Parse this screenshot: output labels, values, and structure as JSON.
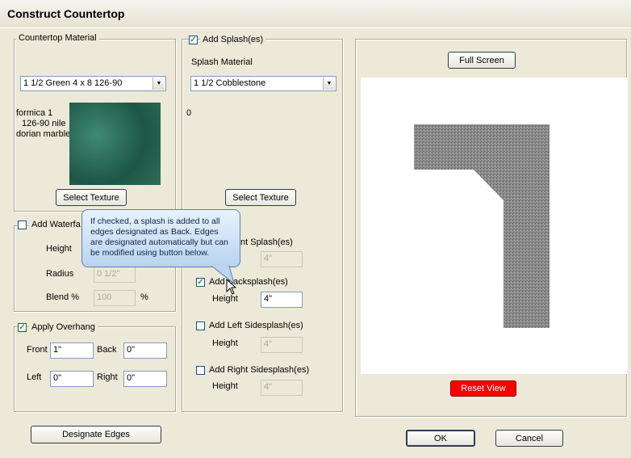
{
  "window": {
    "title": "Construct Countertop"
  },
  "countertop": {
    "group_label": "Countertop Material",
    "material": "1 1/2 Green 4 x 8 126-90",
    "desc": [
      "formica 1",
      "126-90 nile",
      "dorian marble"
    ],
    "select_texture": "Select Texture"
  },
  "waterfall": {
    "label": "Add Waterfa",
    "height_label": "Height",
    "radius_label": "Radius",
    "radius_value": "0 1/2\"",
    "blend_label": "Blend %",
    "blend_value": "100",
    "blend_unit": "%"
  },
  "overhang": {
    "label": "Apply Overhang",
    "front_label": "Front",
    "front_value": "1\"",
    "back_label": "Back",
    "back_value": "0\"",
    "left_label": "Left",
    "left_value": "0\"",
    "right_label": "Right",
    "right_value": "0\""
  },
  "designate_edges": "Designate Edges",
  "splash": {
    "add_label": "Add Splash(es)",
    "material_label": "Splash Material",
    "material": "1 1/2 Cobblestone",
    "count": "0",
    "select_texture": "Select Texture",
    "front_label": "nt Splash(es)",
    "front_height": "4\"",
    "back_label": "Add Backsplash(es)",
    "back_height_label": "Height",
    "back_height": "4\"",
    "left_label": "Add Left Sidesplash(es)",
    "left_height_label": "Height",
    "left_height": "4\"",
    "right_label": "Add Right Sidesplash(es)",
    "right_height_label": "Height",
    "right_height": "4\""
  },
  "tooltip": {
    "text": "If checked, a splash is added to all edges designated as Back. Edges are designated automatically but can be modified using button below."
  },
  "preview": {
    "full_screen": "Full Screen",
    "reset_view": "Reset View",
    "reset_color": "#ff0000",
    "counter_color": "#8a8a8a"
  },
  "buttons": {
    "ok": "OK",
    "cancel": "Cancel"
  }
}
